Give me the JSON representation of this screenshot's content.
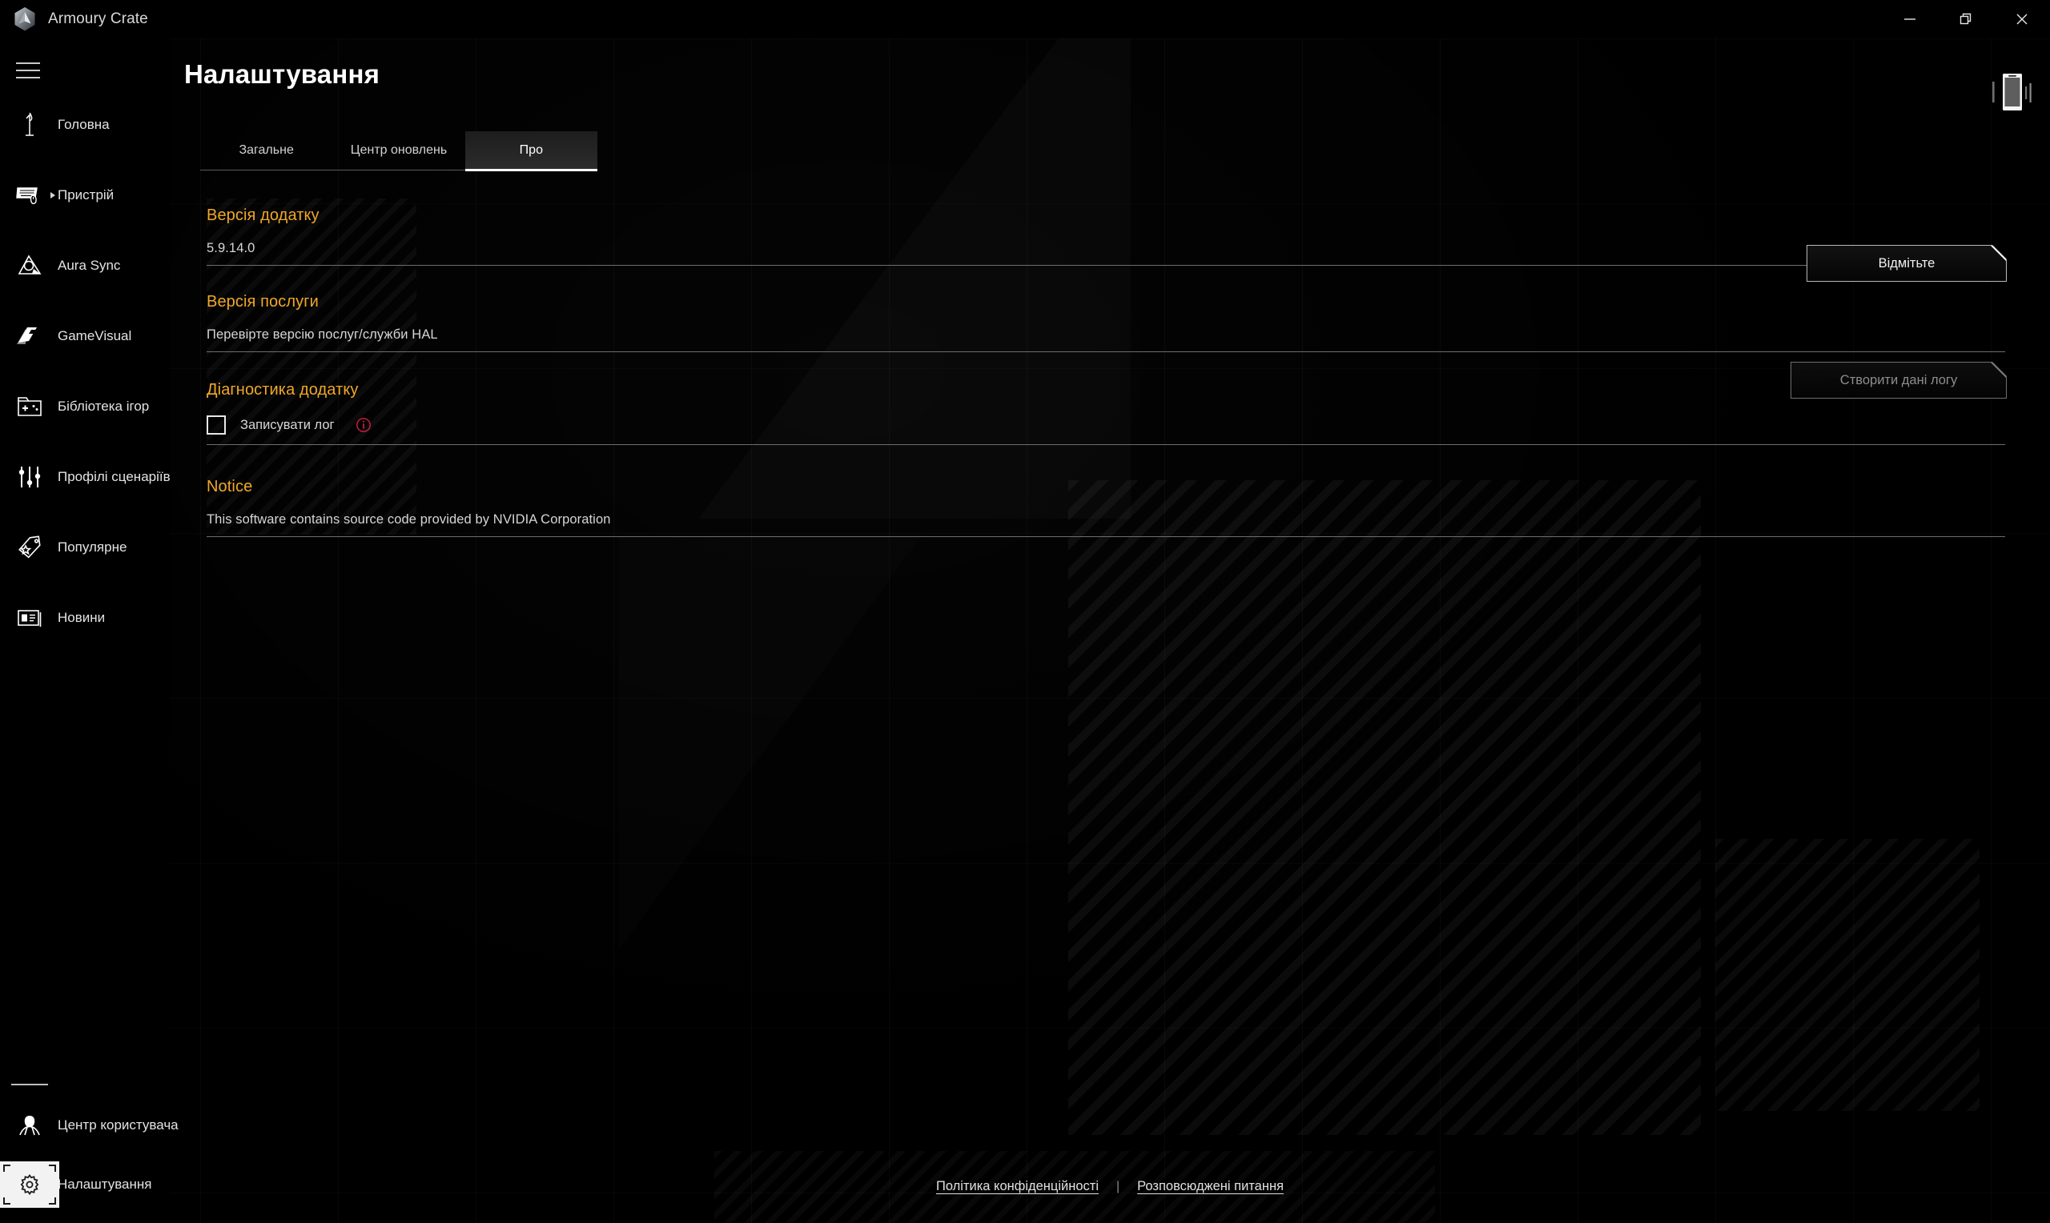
{
  "window": {
    "app_title": "Armoury Crate",
    "logo_icon": "armoury-crate-hex-logo",
    "controls": {
      "minimize": "minimize-icon",
      "maximize": "restore-icon",
      "close": "close-icon"
    }
  },
  "sidebar": {
    "menu_icon": "hamburger-icon",
    "items": [
      {
        "label": "Головна",
        "icon": "home-flame-icon",
        "has_caret": false
      },
      {
        "label": "Пристрій",
        "icon": "device-keyboard-mouse-icon",
        "has_caret": true
      },
      {
        "label": "Aura Sync",
        "icon": "aura-sync-icon",
        "has_caret": false
      },
      {
        "label": "GameVisual",
        "icon": "gamevisual-icon",
        "has_caret": false
      },
      {
        "label": "Бібліотека ігор",
        "icon": "game-library-icon",
        "has_caret": false
      },
      {
        "label": "Профілі сценаріїв",
        "icon": "scenario-sliders-icon",
        "has_caret": false
      },
      {
        "label": "Популярне",
        "icon": "tag-star-icon",
        "has_caret": false
      },
      {
        "label": "Новини",
        "icon": "news-card-icon",
        "has_caret": false
      }
    ],
    "bottom_items": [
      {
        "label": "Центр користувача",
        "icon": "user-center-icon",
        "active": false
      },
      {
        "label": "Налаштування",
        "icon": "gear-icon",
        "active": true
      }
    ]
  },
  "header": {
    "title": "Налаштування",
    "phone_icon": "mobile-device-icon"
  },
  "tabs": [
    {
      "label": "Загальне",
      "active": false
    },
    {
      "label": "Центр оновлень",
      "active": false
    },
    {
      "label": "Про",
      "active": true
    }
  ],
  "sections": {
    "app_version": {
      "heading": "Версія додатку",
      "value": "5.9.14.0"
    },
    "service_version": {
      "heading": "Версія послуги",
      "value": "Перевірте версію послуг/служби HAL",
      "button_label": "Відмітьте"
    },
    "diagnostic": {
      "heading": "Діагностика додатку",
      "checkbox_label": "Записувати лог",
      "checkbox_checked": false,
      "info_icon": "info-circle-icon",
      "button_label": "Створити дані логу",
      "button_disabled": true
    },
    "notice": {
      "heading": "Notice",
      "value": "This software contains source code provided by NVIDIA Corporation"
    }
  },
  "footer": {
    "privacy_link": "Політика конфіденційності",
    "separator": "|",
    "faq_link": "Розповсюджені питання"
  },
  "colors": {
    "accent_orange": "#f0a828",
    "info_red": "#d31f45",
    "text_primary": "#e3e3e3",
    "background": "#000000"
  }
}
